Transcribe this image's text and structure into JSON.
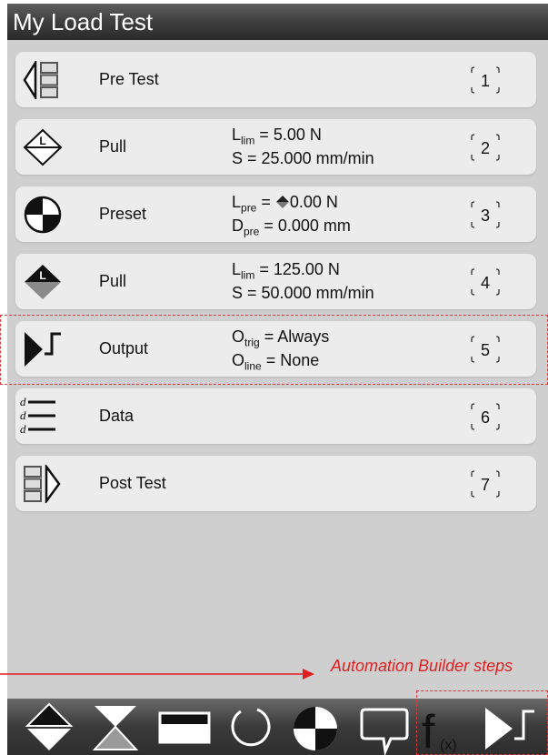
{
  "title": "My Load Test",
  "steps": [
    {
      "number": "1",
      "name": "Pre Test",
      "icon": "pre-test-icon"
    },
    {
      "number": "2",
      "name": "Pull",
      "icon": "pull-limit-icon",
      "p1": {
        "var": "L",
        "sub": "lim",
        "value": " = 5.00 N"
      },
      "p2": {
        "var": "S",
        "sub": "",
        "value": " = 25.000 mm/min"
      }
    },
    {
      "number": "3",
      "name": "Preset",
      "icon": "preset-icon",
      "p1": {
        "var": "L",
        "sub": "pre",
        "value": " = ",
        "arrow": "up-down-arrow-icon",
        "value2": "0.00 N"
      },
      "p2": {
        "var": "D",
        "sub": "pre",
        "value": " = 0.000 mm"
      }
    },
    {
      "number": "4",
      "name": "Pull",
      "icon": "pull-icon",
      "p1": {
        "var": "L",
        "sub": "lim",
        "value": " = 125.00 N"
      },
      "p2": {
        "var": "S",
        "sub": "",
        "value": " = 50.000 mm/min"
      }
    },
    {
      "number": "5",
      "name": "Output",
      "icon": "output-icon",
      "p1": {
        "var": "O",
        "sub": "trig",
        "value": " = Always"
      },
      "p2": {
        "var": "O",
        "sub": "line",
        "value": " = None"
      }
    },
    {
      "number": "6",
      "name": "Data",
      "icon": "data-icon",
      "icon_letter": "d"
    },
    {
      "number": "7",
      "name": "Post Test",
      "icon": "post-test-icon"
    }
  ],
  "annotation": {
    "label": "Automation Builder steps",
    "color": "#e02020"
  },
  "toolbar": {
    "items": [
      "pull-compress-icon",
      "hourglass-icon",
      "rectangle-icon",
      "cycle-icon",
      "preset-icon",
      "comment-icon",
      "function-icon",
      "output-icon"
    ],
    "function_label": "f",
    "function_sub": "(x)"
  },
  "colors": {
    "titlebar": "#3c3c3c",
    "panel": "#cfcfcf",
    "step_bg": "#ececec",
    "accent_red": "#e02020"
  }
}
